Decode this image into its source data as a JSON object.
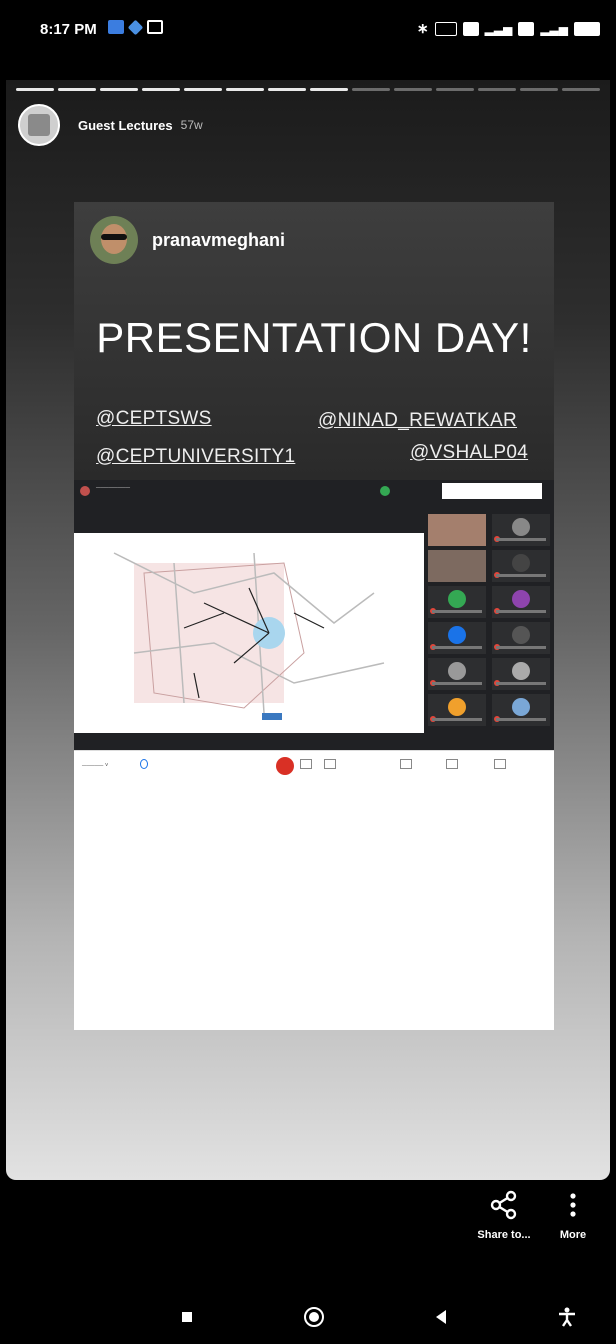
{
  "status_bar": {
    "time": "8:17 PM",
    "notification_icons": [
      "email-icon",
      "diamond-icon",
      "photo-icon"
    ],
    "system_icons": [
      "bluetooth-icon",
      "vpn-icon",
      "volte-icon",
      "signal-icon",
      "volte-icon",
      "signal-icon",
      "battery-icon"
    ]
  },
  "story": {
    "account": "Guest Lectures",
    "time_ago": "57w",
    "progress": {
      "segments": 14,
      "current": 8
    },
    "post": {
      "author": "pranavmeghani",
      "headline": "PRESENTATION DAY!",
      "tags": [
        "@CEPTSWS",
        "@NINAD_REWATKAR",
        "@CEPTUNIVERSITY1",
        "@VSHALP04"
      ]
    }
  },
  "actions": {
    "share_label": "Share to...",
    "more_label": "More"
  },
  "colors": {
    "background": "#000000",
    "meet_dark": "#202124",
    "end_call": "#d93025"
  }
}
